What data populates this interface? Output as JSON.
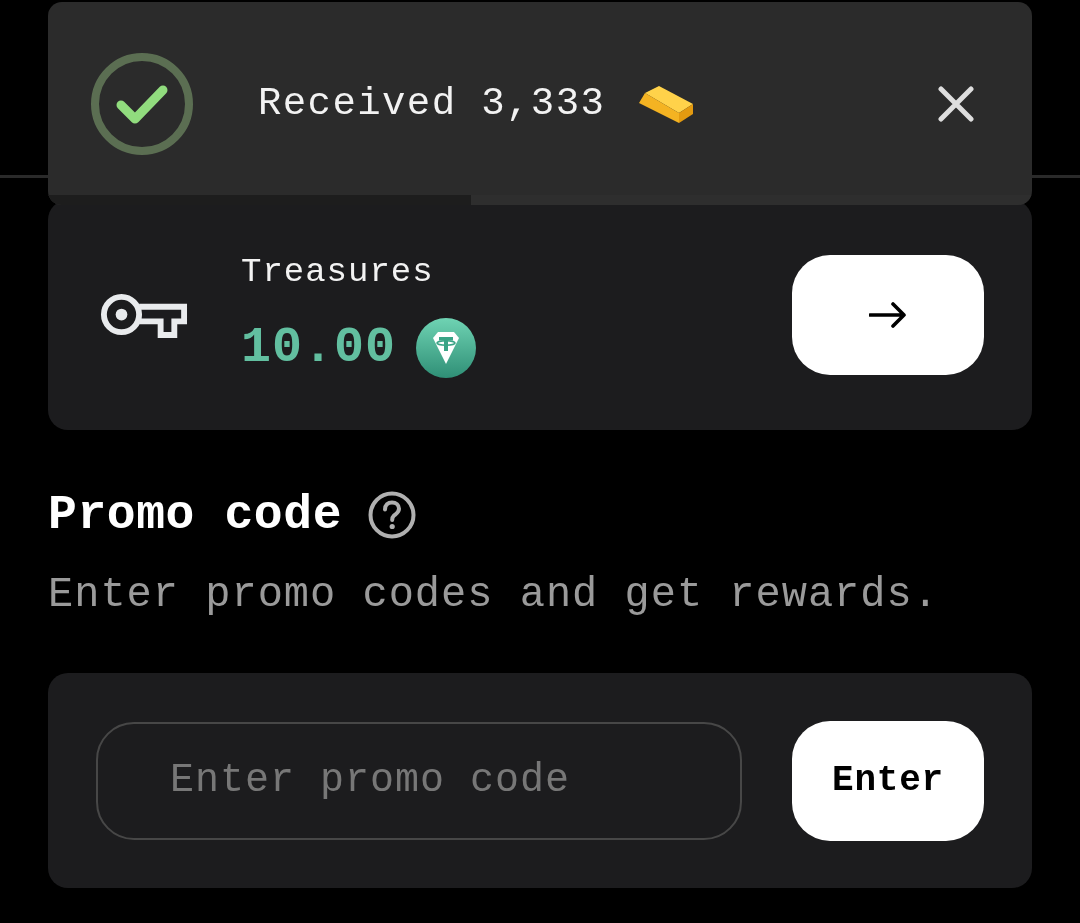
{
  "toast": {
    "message": "Received 3,333",
    "timer": {
      "level": 0.43
    }
  },
  "treasures": {
    "title": "Treasures",
    "amount": "10.00"
  },
  "promo": {
    "title": "Promo code",
    "description": "Enter promo codes and get rewards.",
    "input": {
      "placeholder": "Enter promo code"
    },
    "button": "Enter"
  }
}
